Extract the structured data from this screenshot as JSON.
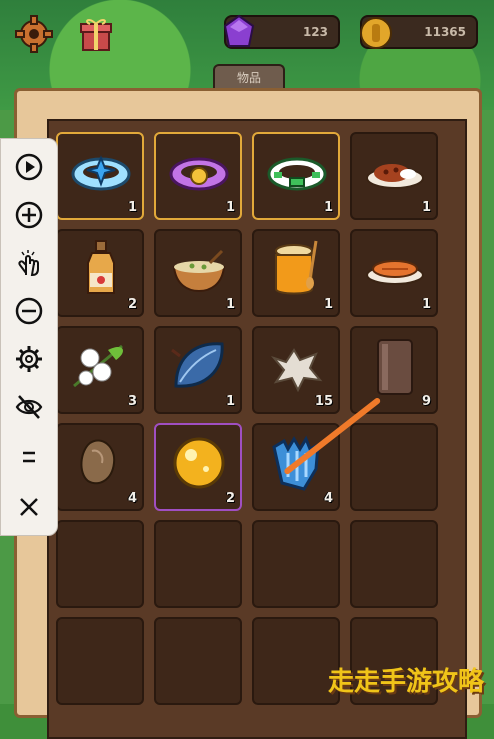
{
  "topbar": {
    "gems": "123",
    "coins": "11365"
  },
  "inventory": {
    "tab_label": "物品",
    "slots": [
      {
        "item": "blue-ring-icon",
        "count": "1",
        "frame": "gold"
      },
      {
        "item": "purple-ring-icon",
        "count": "1",
        "frame": "gold"
      },
      {
        "item": "green-ring-icon",
        "count": "1",
        "frame": "gold"
      },
      {
        "item": "curry-dish-icon",
        "count": "1",
        "frame": "none"
      },
      {
        "item": "potion-bottle-icon",
        "count": "2",
        "frame": "none"
      },
      {
        "item": "soup-bowl-icon",
        "count": "1",
        "frame": "none"
      },
      {
        "item": "honey-jar-icon",
        "count": "1",
        "frame": "none"
      },
      {
        "item": "grilled-fish-icon",
        "count": "1",
        "frame": "none"
      },
      {
        "item": "cotton-flower-icon",
        "count": "3",
        "frame": "none"
      },
      {
        "item": "blue-leaf-icon",
        "count": "1",
        "frame": "none"
      },
      {
        "item": "fur-pelt-icon",
        "count": "15",
        "frame": "none"
      },
      {
        "item": "glass-jar-icon",
        "count": "9",
        "frame": "none"
      },
      {
        "item": "stone-icon",
        "count": "4",
        "frame": "none"
      },
      {
        "item": "amber-orb-icon",
        "count": "2",
        "frame": "purple"
      },
      {
        "item": "ice-crystal-icon",
        "count": "4",
        "frame": "none"
      },
      {
        "item": "",
        "count": "",
        "frame": "none"
      },
      {
        "item": "",
        "count": "",
        "frame": "none"
      },
      {
        "item": "",
        "count": "",
        "frame": "none"
      },
      {
        "item": "",
        "count": "",
        "frame": "none"
      },
      {
        "item": "",
        "count": "",
        "frame": "none"
      },
      {
        "item": "",
        "count": "",
        "frame": "none"
      },
      {
        "item": "",
        "count": "",
        "frame": "none"
      },
      {
        "item": "",
        "count": "",
        "frame": "none"
      },
      {
        "item": "",
        "count": "",
        "frame": "none"
      }
    ]
  },
  "watermark": "走走手游攻略"
}
